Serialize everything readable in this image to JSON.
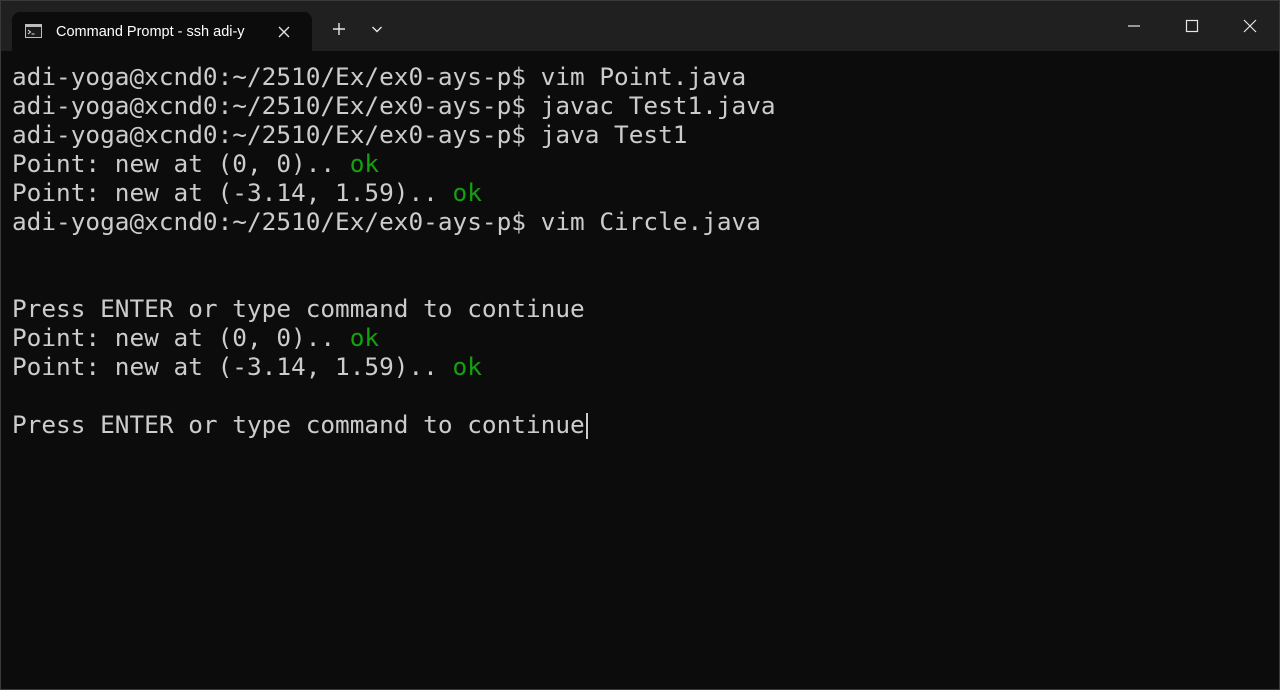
{
  "window": {
    "tab_title": "Command Prompt - ssh  adi-y",
    "icons": {
      "tab": "terminal-icon",
      "tab_close": "close-icon",
      "new_tab": "plus-icon",
      "dropdown": "chevron-down-icon",
      "minimize": "minimize-icon",
      "maximize": "maximize-icon",
      "close": "close-icon"
    }
  },
  "colors": {
    "terminal_bg": "#0c0c0c",
    "titlebar_bg": "#202020",
    "text": "#cccccc",
    "ok_green": "#13a10e"
  },
  "terminal": {
    "lines": [
      {
        "text": "adi-yoga@xcnd0:~/2510/Ex/ex0-ays-p$ vim Point.java"
      },
      {
        "text": "adi-yoga@xcnd0:~/2510/Ex/ex0-ays-p$ javac Test1.java"
      },
      {
        "text": "adi-yoga@xcnd0:~/2510/Ex/ex0-ays-p$ java Test1"
      },
      {
        "text": "Point: new at (0, 0).. ",
        "status": "ok"
      },
      {
        "text": "Point: new at (-3.14, 1.59).. ",
        "status": "ok"
      },
      {
        "text": "adi-yoga@xcnd0:~/2510/Ex/ex0-ays-p$ vim Circle.java"
      },
      {
        "text": ""
      },
      {
        "text": ""
      },
      {
        "text": "Press ENTER or type command to continue"
      },
      {
        "text": "Point: new at (0, 0).. ",
        "status": "ok"
      },
      {
        "text": "Point: new at (-3.14, 1.59).. ",
        "status": "ok"
      },
      {
        "text": ""
      },
      {
        "text": "Press ENTER or type command to continue",
        "cursor": true
      }
    ]
  }
}
